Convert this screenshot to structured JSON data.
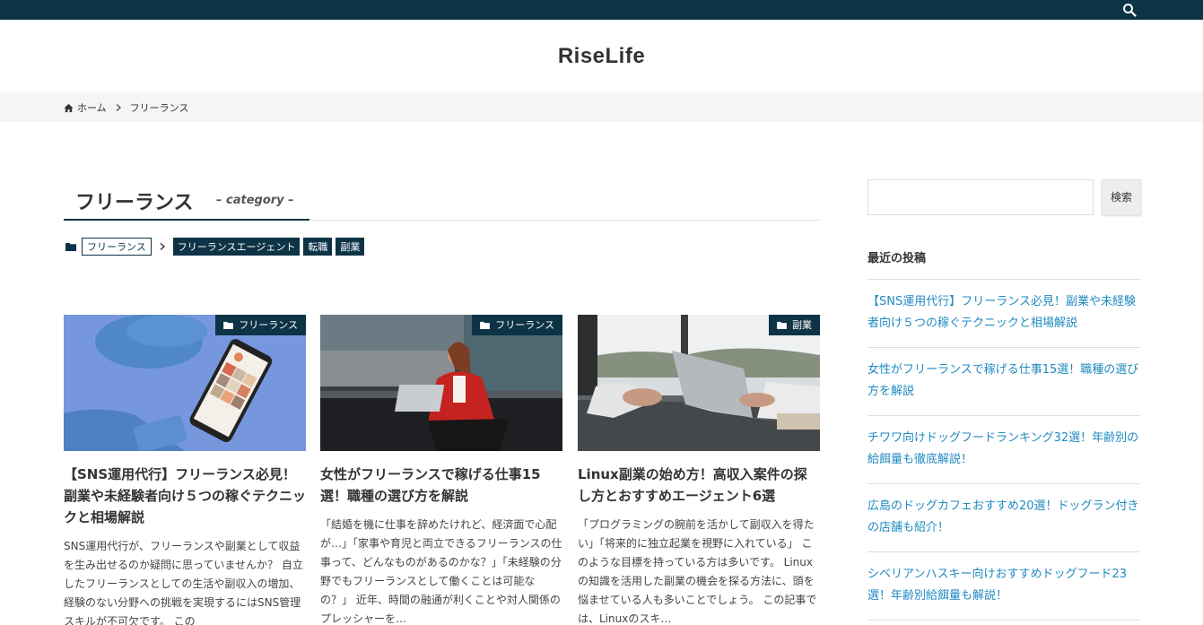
{
  "site": {
    "title": "RiseLife"
  },
  "breadcrumb": {
    "home": "ホーム",
    "current": "フリーランス"
  },
  "category": {
    "title": "フリーランス",
    "subtitle": "– category –"
  },
  "tags": {
    "parent": "フリーランス",
    "children": [
      "フリーランスエージェント",
      "転職",
      "副業"
    ]
  },
  "cards": [
    {
      "category": "フリーランス",
      "title": "【SNS運用代行】フリーランス必見！副業や未経験者向け５つの稼ぐテクニックと相場解説",
      "excerpt": "SNS運用代行が、フリーランスや副業として収益を生み出せるのか疑問に思っていませんか？ 自立したフリーランスとしての生活や副収入の増加、経験のない分野への挑戦を実現するにはSNS管理スキルが不可欠です。 この",
      "image": "phone-on-blue-table"
    },
    {
      "category": "フリーランス",
      "title": "女性がフリーランスで稼げる仕事15選！職種の選び方を解説",
      "excerpt": "「結婚を機に仕事を辞めたけれど、経済面で心配が…」「家事や育児と両立できるフリーランスの仕事って、どんなものがあるのかな？」「未経験の分野でもフリーランスとして働くことは可能なの？」 近年、時間の融通が利くことや対人関係のプレッシャーを…",
      "image": "woman-with-laptop"
    },
    {
      "category": "副業",
      "title": "Linux副業の始め方！高収入案件の探し方とおすすめエージェント6選",
      "excerpt": "「プログラミングの腕前を活かして副収入を得たい」「将来的に独立起業を視野に入れている」 このような目標を持っている方は多いです。 Linuxの知識を活用した副業の機会を探る方法に、頭を悩ませている人も多いことでしょう。 この記事では、Linuxのスキ…",
      "image": "hands-on-laptop"
    }
  ],
  "sidebar": {
    "search_button": "検索",
    "search_placeholder": "",
    "recent_title": "最近の投稿",
    "recent_posts": [
      "【SNS運用代行】フリーランス必見！副業や未経験者向け５つの稼ぐテクニックと相場解説",
      "女性がフリーランスで稼げる仕事15選！職種の選び方を解説",
      "チワワ向けドッグフードランキング32選！年齢別の給餌量も徹底解説！",
      "広島のドッグカフェおすすめ20選！ドッグラン付きの店舗も紹介！",
      "シベリアンハスキー向けおすすめドッグフード23選！年齢別給餌量も解説！"
    ]
  },
  "colors": {
    "navy": "#0d3346",
    "link": "#1f8ac0"
  },
  "icons": [
    "search-icon",
    "home-icon",
    "chevron-right-icon",
    "folder-icon"
  ]
}
